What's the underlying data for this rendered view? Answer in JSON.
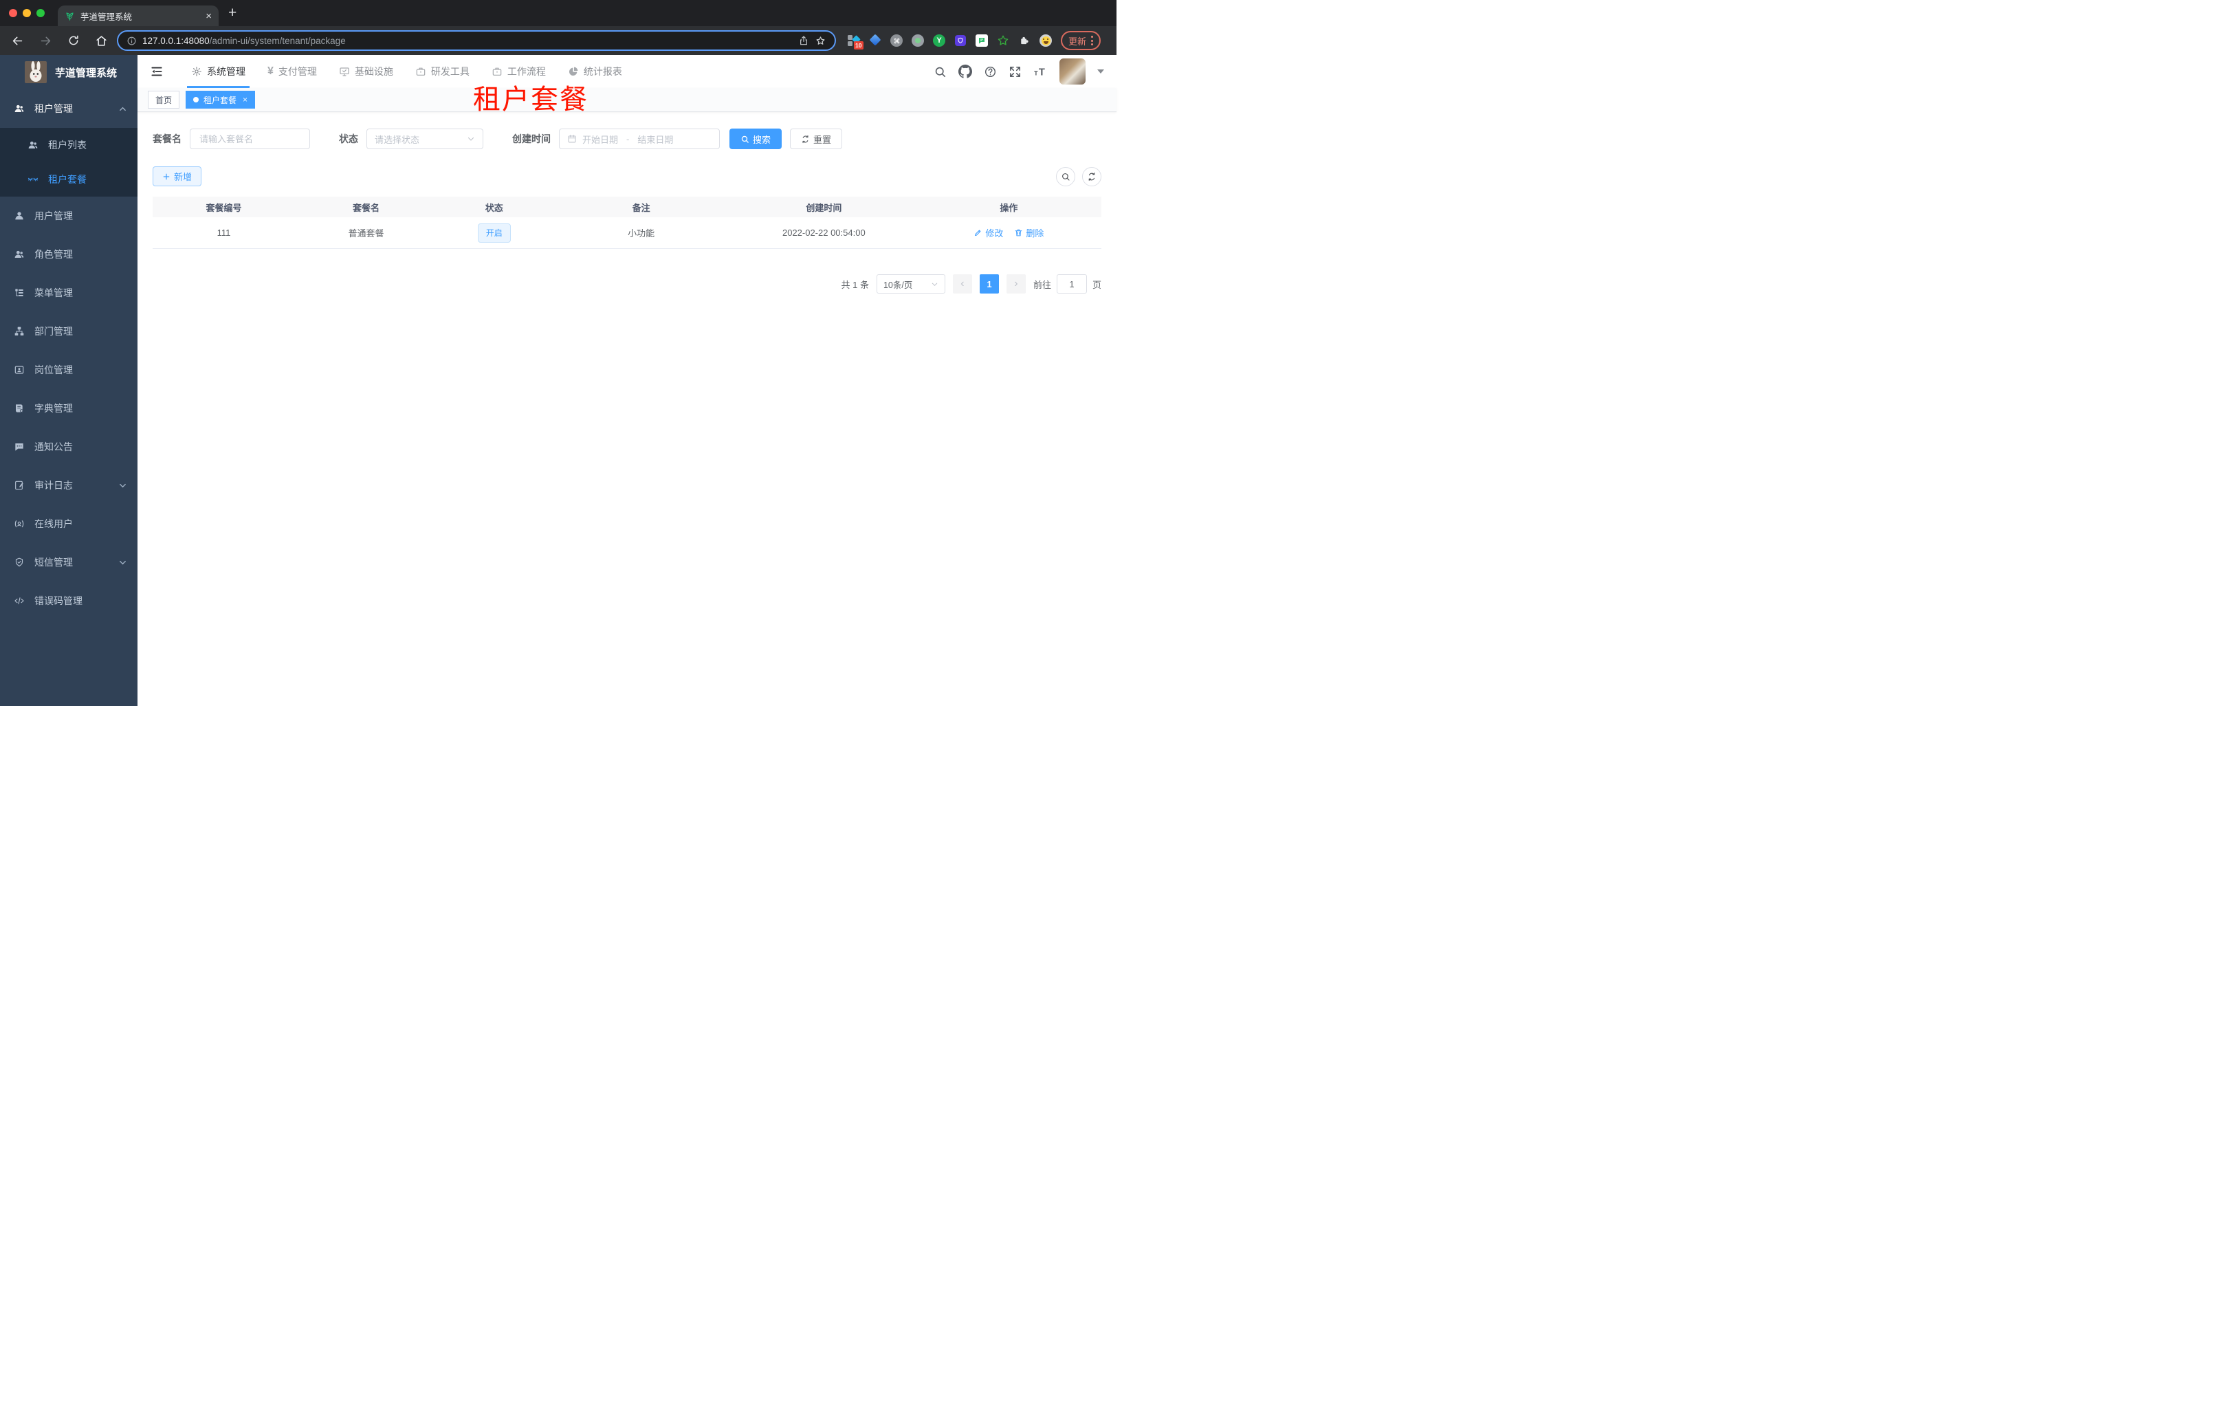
{
  "colors": {
    "primary": "#409eff",
    "sidebar_bg": "#304156",
    "submenu_bg": "#1f2d3d",
    "red_title": "#fe1600",
    "status_tag_bg": "#e9f4ff",
    "active_tag_bg": "#409eff",
    "update_button": "#ec8376",
    "traffic_red": "#ff5f57",
    "traffic_yellow": "#febc2e",
    "traffic_green": "#28c840"
  },
  "browser": {
    "tab_title": "芋道管理系统",
    "url_host": "127.0.0.1:48080",
    "url_path": "/admin-ui/system/tenant/package",
    "update_label": "更新",
    "extension_badge": "10",
    "new_tab_glyph": "+",
    "tab_close_glyph": "×"
  },
  "sidebar": {
    "logo_title": "芋道管理系统",
    "items": [
      {
        "label": "租户管理",
        "icon": "tenant-users-icon",
        "state": "expanded"
      },
      {
        "label": "租户列表",
        "icon": "tenant-list-icon",
        "sub": true
      },
      {
        "label": "租户套餐",
        "icon": "lashes-icon",
        "sub": true,
        "active": true
      },
      {
        "label": "用户管理",
        "icon": "user-icon"
      },
      {
        "label": "角色管理",
        "icon": "roles-icon"
      },
      {
        "label": "菜单管理",
        "icon": "menu-tree-icon"
      },
      {
        "label": "部门管理",
        "icon": "org-icon"
      },
      {
        "label": "岗位管理",
        "icon": "post-badge-icon"
      },
      {
        "label": "字典管理",
        "icon": "dict-book-icon"
      },
      {
        "label": "通知公告",
        "icon": "notice-chat-icon"
      },
      {
        "label": "审计日志",
        "icon": "audit-log-icon",
        "state": "collapsed"
      },
      {
        "label": "在线用户",
        "icon": "online-user-icon"
      },
      {
        "label": "短信管理",
        "icon": "sms-shield-icon",
        "state": "collapsed"
      },
      {
        "label": "错误码管理",
        "icon": "error-code-icon"
      }
    ]
  },
  "topnav": {
    "items": [
      {
        "label": "系统管理",
        "icon": "gear-icon",
        "active": true
      },
      {
        "label": "支付管理",
        "icon": "yen-icon"
      },
      {
        "label": "基础设施",
        "icon": "monitor-icon"
      },
      {
        "label": "研发工具",
        "icon": "briefcase-icon"
      },
      {
        "label": "工作流程",
        "icon": "briefcase-icon"
      },
      {
        "label": "统计报表",
        "icon": "pie-chart-icon"
      }
    ],
    "yen_glyph": "¥"
  },
  "tags": {
    "home": "首页",
    "active": "租户套餐",
    "close_glyph": "×"
  },
  "page": {
    "red_title": "租户套餐"
  },
  "filters": {
    "name_label": "套餐名",
    "name_placeholder": "请输入套餐名",
    "status_label": "状态",
    "status_placeholder": "请选择状态",
    "date_label": "创建时间",
    "date_start_placeholder": "开始日期",
    "date_separator": "-",
    "date_end_placeholder": "结束日期",
    "search_label": "搜索",
    "reset_label": "重置"
  },
  "toolbar": {
    "add_label": "新增"
  },
  "table": {
    "headers": [
      "套餐编号",
      "套餐名",
      "状态",
      "备注",
      "创建时间",
      "操作"
    ],
    "rows": [
      {
        "id": "111",
        "name": "普通套餐",
        "status": "开启",
        "remark": "小功能",
        "created_at": "2022-02-22 00:54:00",
        "edit_label": "修改",
        "delete_label": "删除"
      }
    ]
  },
  "pagination": {
    "total": "共 1 条",
    "page_size": "10条/页",
    "prev_glyph": "‹",
    "next_glyph": "›",
    "current_page": "1",
    "goto_prefix": "前往",
    "goto_value": "1",
    "goto_suffix": "页"
  }
}
